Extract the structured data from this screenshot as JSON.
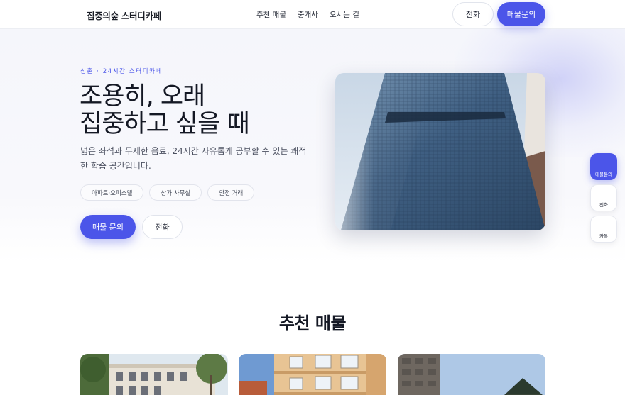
{
  "header": {
    "logo": "집중의숲 스터디카페",
    "nav": [
      "추천 매물",
      "중개사",
      "오시는 길"
    ],
    "call_label": "전화",
    "inquiry_label": "매물문의"
  },
  "hero": {
    "eyebrow": "신촌 · 24시간 스터디카페",
    "title_line1": "조용히, 오래",
    "title_line2": "집중하고 싶을 때",
    "description": "넓은 좌석과 무제한 음료, 24시간 자유롭게 공부할 수 있는 쾌적한 학습 공간입니다.",
    "chips": [
      "아파트·오피스텔",
      "상가·사무실",
      "안전 거래"
    ],
    "cta_inquiry": "매물 문의",
    "cta_call": "전화"
  },
  "floating": {
    "inquiry": "매물문의",
    "call": "전화",
    "talk": "카톡"
  },
  "listings": {
    "title": "추천 매물"
  },
  "colors": {
    "accent": "#4b55e9",
    "text": "#141824"
  }
}
